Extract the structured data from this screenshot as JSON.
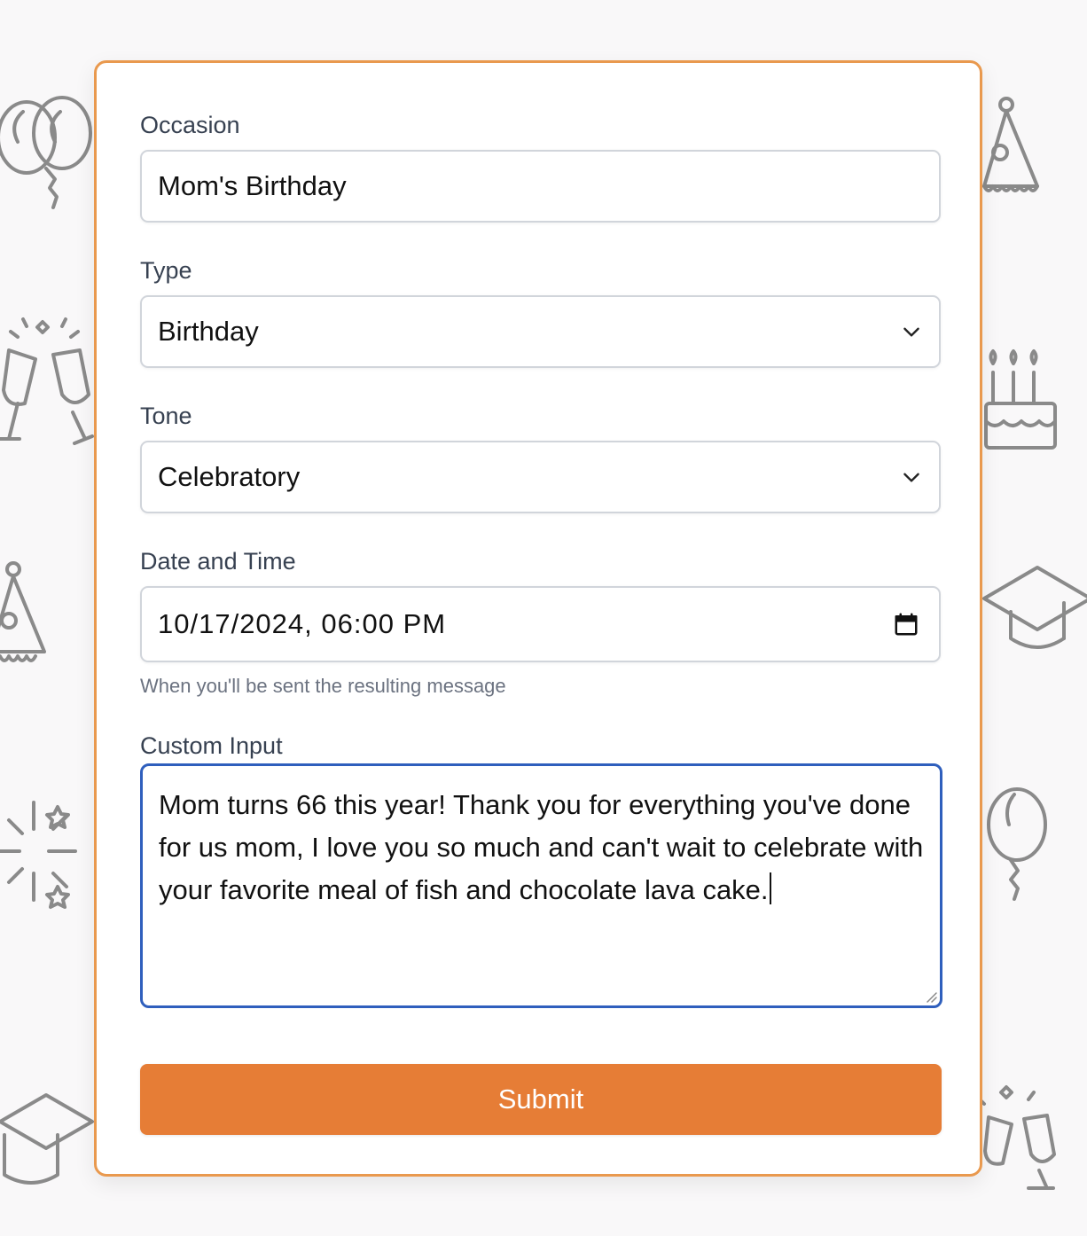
{
  "form": {
    "occasion": {
      "label": "Occasion",
      "value": "Mom's Birthday"
    },
    "type": {
      "label": "Type",
      "value": "Birthday"
    },
    "tone": {
      "label": "Tone",
      "value": "Celebratory"
    },
    "datetime": {
      "label": "Date and Time",
      "value": "10/17/2024, 06:00 PM",
      "hint": "When you'll be sent the resulting message"
    },
    "custom": {
      "label": "Custom Input",
      "value": "Mom turns 66 this year! Thank you for everything you've done for us mom, I love you so much and can't wait to celebrate with your favorite meal of fish and chocolate lava cake."
    },
    "submit_label": "Submit"
  },
  "colors": {
    "card_border": "#e9994e",
    "submit_bg": "#e67d36",
    "focus_border": "#2f5fbd",
    "page_bg": "#f9f8f9"
  },
  "icons": {
    "background": [
      "balloons-icon",
      "party-hat-icon",
      "champagne-toast-icon",
      "birthday-cake-icon",
      "graduation-cap-icon",
      "fireworks-icon",
      "balloon-icon"
    ],
    "type_select": "chevron-down-icon",
    "tone_select": "chevron-down-icon",
    "datetime": "calendar-icon"
  }
}
